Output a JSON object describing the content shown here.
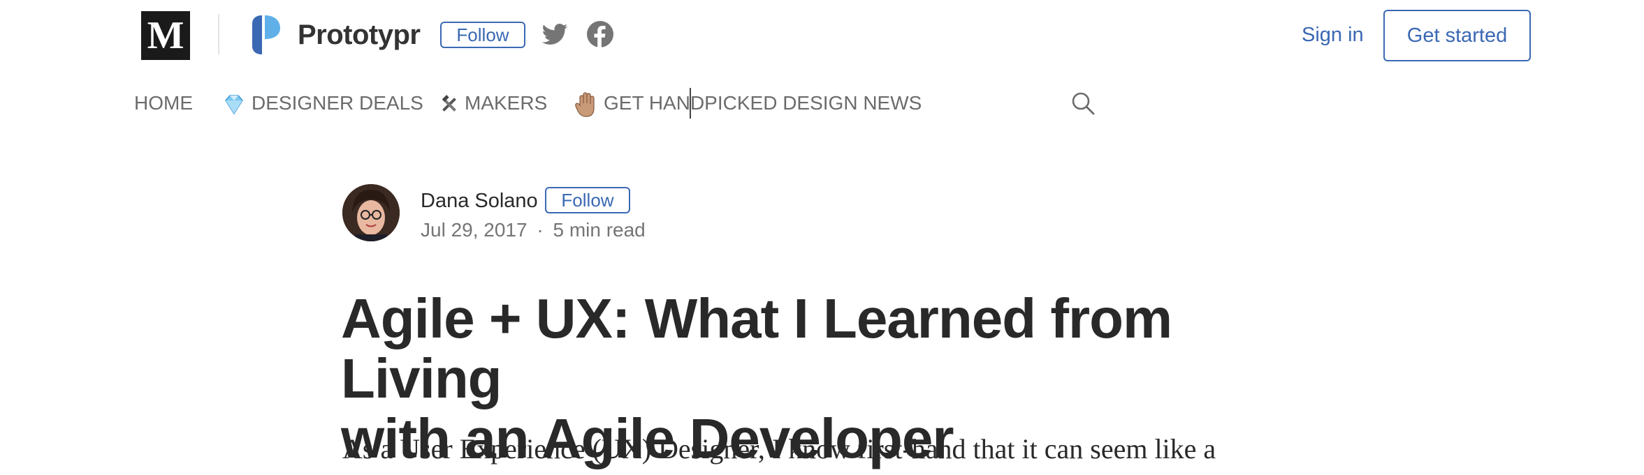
{
  "header": {
    "logo_letter": "M",
    "publication_name": "Prototypr",
    "follow_label": "Follow",
    "social_icons": [
      "twitter-icon",
      "facebook-icon"
    ],
    "sign_in_label": "Sign in",
    "get_started_label": "Get started",
    "accent_color": "#3a68b3"
  },
  "nav": {
    "items": [
      {
        "label": "HOME",
        "icon": ""
      },
      {
        "label": "DESIGNER DEALS",
        "icon": "gem-icon"
      },
      {
        "label": "MAKERS",
        "icon": "hammer-wrench-icon"
      },
      {
        "label": "GET HANDPICKED DESIGN NEWS",
        "icon": "raised-hand-icon"
      }
    ],
    "search_icon": "search-icon"
  },
  "article": {
    "author_name": "Dana Solano",
    "follow_label": "Follow",
    "date": "Jul 29, 2017",
    "separator": "·",
    "read_time": "5 min read",
    "title_line1": "Agile + UX: What I Learned from Living",
    "title_line2": "with an Agile Developer",
    "first_line": "As a User Experience (UX) Designer, I know first-hand that it can seem like a"
  }
}
